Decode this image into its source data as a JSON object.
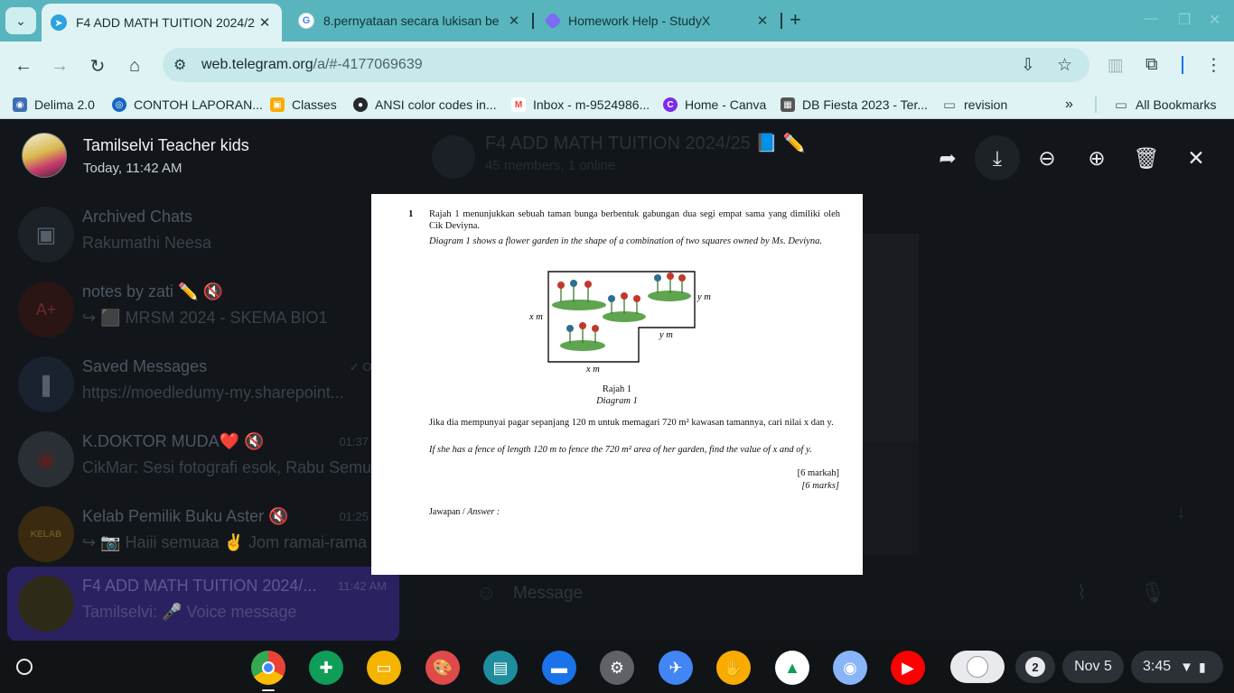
{
  "browser": {
    "tabs": [
      {
        "title": "F4 ADD MATH TUITION 2024/2",
        "icon": "telegram-icon",
        "active": true
      },
      {
        "title": "8.pernyataan secara lukisan be",
        "icon": "google-icon",
        "active": false
      },
      {
        "title": "Homework Help - StudyX",
        "icon": "studyx-icon",
        "active": false
      }
    ],
    "url_host": "web.telegram.org",
    "url_path": "/a/#-4177069639",
    "bookmarks": [
      {
        "label": "Delima 2.0",
        "icon": "globe-icon",
        "color": "#3d6fb6"
      },
      {
        "label": "CONTOH LAPORAN...",
        "icon": "app-icon",
        "color": "#1565c0"
      },
      {
        "label": "Classes",
        "icon": "classroom-icon",
        "color": "#f9ab00"
      },
      {
        "label": "ANSI color codes in...",
        "icon": "github-icon",
        "color": "#24292e"
      },
      {
        "label": "Inbox - m-9524986...",
        "icon": "gmail-icon",
        "color": "#ea4335"
      },
      {
        "label": "Home - Canva",
        "icon": "canva-icon",
        "color": "#7d2ae8"
      },
      {
        "label": "DB Fiesta 2023 - Ter...",
        "icon": "building-icon",
        "color": "#555555"
      },
      {
        "label": "revision",
        "icon": "folder-icon",
        "color": "#5f6368"
      }
    ],
    "all_bookmarks": "All Bookmarks"
  },
  "viewer": {
    "author": "Tamilselvi Teacher kids",
    "date": "Today, 11:42 AM"
  },
  "chats": [
    {
      "title": "Archived Chats",
      "subtitle": "Rakumathi Neesa",
      "time": "",
      "avatar": "archive-icon"
    },
    {
      "title": "notes by zati ✏️ 🔇",
      "subtitle": "↪ ⬛ MRSM 2024 - SKEMA BIO1",
      "time": "",
      "avatar": "A+"
    },
    {
      "title": "Saved Messages",
      "subtitle": "https://moedledumy-my.sharepoint...",
      "time": "✓ Oc",
      "avatar": "bookmark-icon"
    },
    {
      "title": "K.DOKTOR MUDA❤️ 🔇",
      "subtitle": "CikMar: Sesi fotografi esok, Rabu Semu",
      "time": "01:37",
      "avatar": "logo"
    },
    {
      "title": "Kelab Pemilik Buku Aster 🔇",
      "subtitle": "↪ 📷 Haiii semuaa ✌️ Jom ramai-rama",
      "time": "01:25",
      "avatar": "KELAB"
    },
    {
      "title": "F4 ADD MATH TUITION 2024/...",
      "subtitle": "Tamilselvi: 🎤 Voice message",
      "time": "11:42 AM",
      "avatar": "group",
      "selected": true
    }
  ],
  "chat_header": {
    "title": "F4 ADD MATH TUITION 2024/25 📘 ✏️",
    "subtitle": "45 members, 1 online"
  },
  "composer_placeholder": "Message",
  "document": {
    "question_number": "1",
    "malay_intro": "Rajah 1 menunjukkan sebuah taman bunga berbentuk gabungan dua segi empat sama yang dimiliki oleh Cik Deviyna.",
    "english_intro": "Diagram 1 shows a flower garden in the shape of a combination of two squares owned by Ms. Deviyna.",
    "labels": {
      "y_top": "y m",
      "x_left": "x m",
      "y_inner": "y m",
      "x_bottom": "x m"
    },
    "caption_malay": "Rajah 1",
    "caption_english": "Diagram 1",
    "malay_question": "Jika dia mempunyai pagar sepanjang 120 m untuk memagari 720 m² kawasan tamannya, cari nilai x dan y.",
    "english_question": "If she has a fence of length 120 m to fence the 720 m² area of her garden, find the value of x and of y.",
    "marks_malay": "[6 markah]",
    "marks_english": "[6 marks]",
    "answer_label_malay": "Jawapan / ",
    "answer_label_english": "Answer :"
  },
  "shelf": {
    "notifications": "2",
    "date": "Nov 5",
    "time": "3:45"
  }
}
